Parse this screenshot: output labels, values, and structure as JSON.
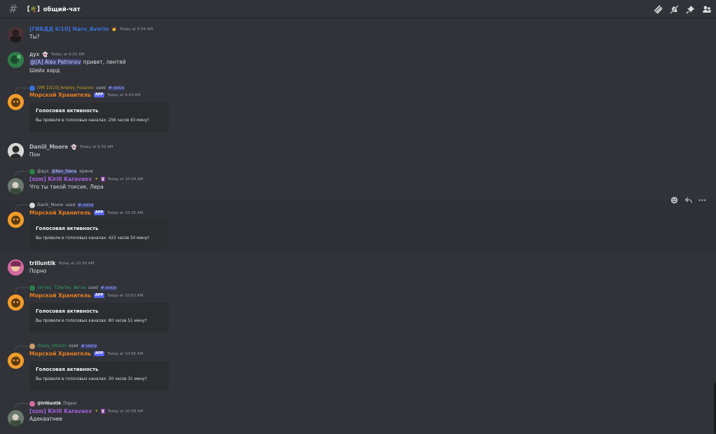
{
  "channel": {
    "hash": "#",
    "name": "【🌴】общий-чат"
  },
  "header_icons": [
    "threads-icon",
    "mute-bell-icon",
    "pin-icon",
    "members-icon"
  ],
  "messages": {
    "m1": {
      "user": "[ГИБДД 6/10] Haru_Averin",
      "time": "Today at 9:34 AM",
      "text": "Ты?"
    },
    "m2": {
      "user": "дух",
      "time": "Today at 9:35 AM",
      "mention": "@[A] Alex Patronov",
      "text": "привет, лентяй",
      "text2": "Шейх хард"
    },
    "m3": {
      "reply_user": "[УМ 10/10] Andrey_Fozanov",
      "reply_used": "used",
      "reply_chan": "# voice",
      "user": "Морской Хранитель",
      "tag": "APP",
      "time": "Today at 9:43 AM",
      "embed_title": "Голосовая активность",
      "embed_desc": "Вы провели в голосовых каналах: 256 часов 43 минут"
    },
    "m4": {
      "user": "Daniil_Moore",
      "time": "Today at 9:59 AM",
      "text": "Пон"
    },
    "m5": {
      "reply_user": "@дух",
      "reply_mention": "@Ken_Slena",
      "reply_text": "кринж",
      "user": "[szm] Kirill Karavaev",
      "time": "Today at 10:04 AM",
      "text": "Что ты такой токсик, Лера"
    },
    "m6": {
      "reply_user": "Daniil_Moore",
      "reply_used": "used",
      "reply_chan": "# voice",
      "user": "Морской Хранитель",
      "tag": "APP",
      "time": "Today at 10:26 AM",
      "embed_title": "Голосовая активность",
      "embed_desc": "Вы провели в голосовых каналах: 423 часов 50 минут"
    },
    "m7": {
      "user": "trilluntik",
      "time": "Today at 10:29 AM",
      "text": "Порно"
    },
    "m8": {
      "reply_user": "[m|vm] Timofey Below",
      "reply_used": "used",
      "reply_chan": "# voice",
      "user": "Морской Хранитель",
      "tag": "APP",
      "time": "Today at 10:53 AM",
      "embed_title": "Голосовая активность",
      "embed_desc": "Вы провели в голосовых каналах: 80 часов 51 минут"
    },
    "m9": {
      "reply_user": "Vitaliy_Shturin",
      "reply_used": "used",
      "reply_chan": "# voice",
      "user": "Морской Хранитель",
      "tag": "APP",
      "time": "Today at 10:56 AM",
      "embed_title": "Голосовая активность",
      "embed_desc": "Вы провели в голосовых каналах: 30 часов 31 минут"
    },
    "m10": {
      "reply_user": "@trilluntik",
      "reply_text": "Порно",
      "user": "[szm] Kirill Karavaev",
      "time": "Today at 10:58 AM",
      "text": "Адекватнее"
    }
  },
  "colors": {
    "haru": "#3b6fd6",
    "bot": "#e67e22",
    "daniil": "#b5bac1",
    "kirill": "#a163d8",
    "fozanov": "#c9a227",
    "timofey": "#2fa36b",
    "vitaliy": "#2fa36b",
    "white": "#f2f3f5"
  }
}
